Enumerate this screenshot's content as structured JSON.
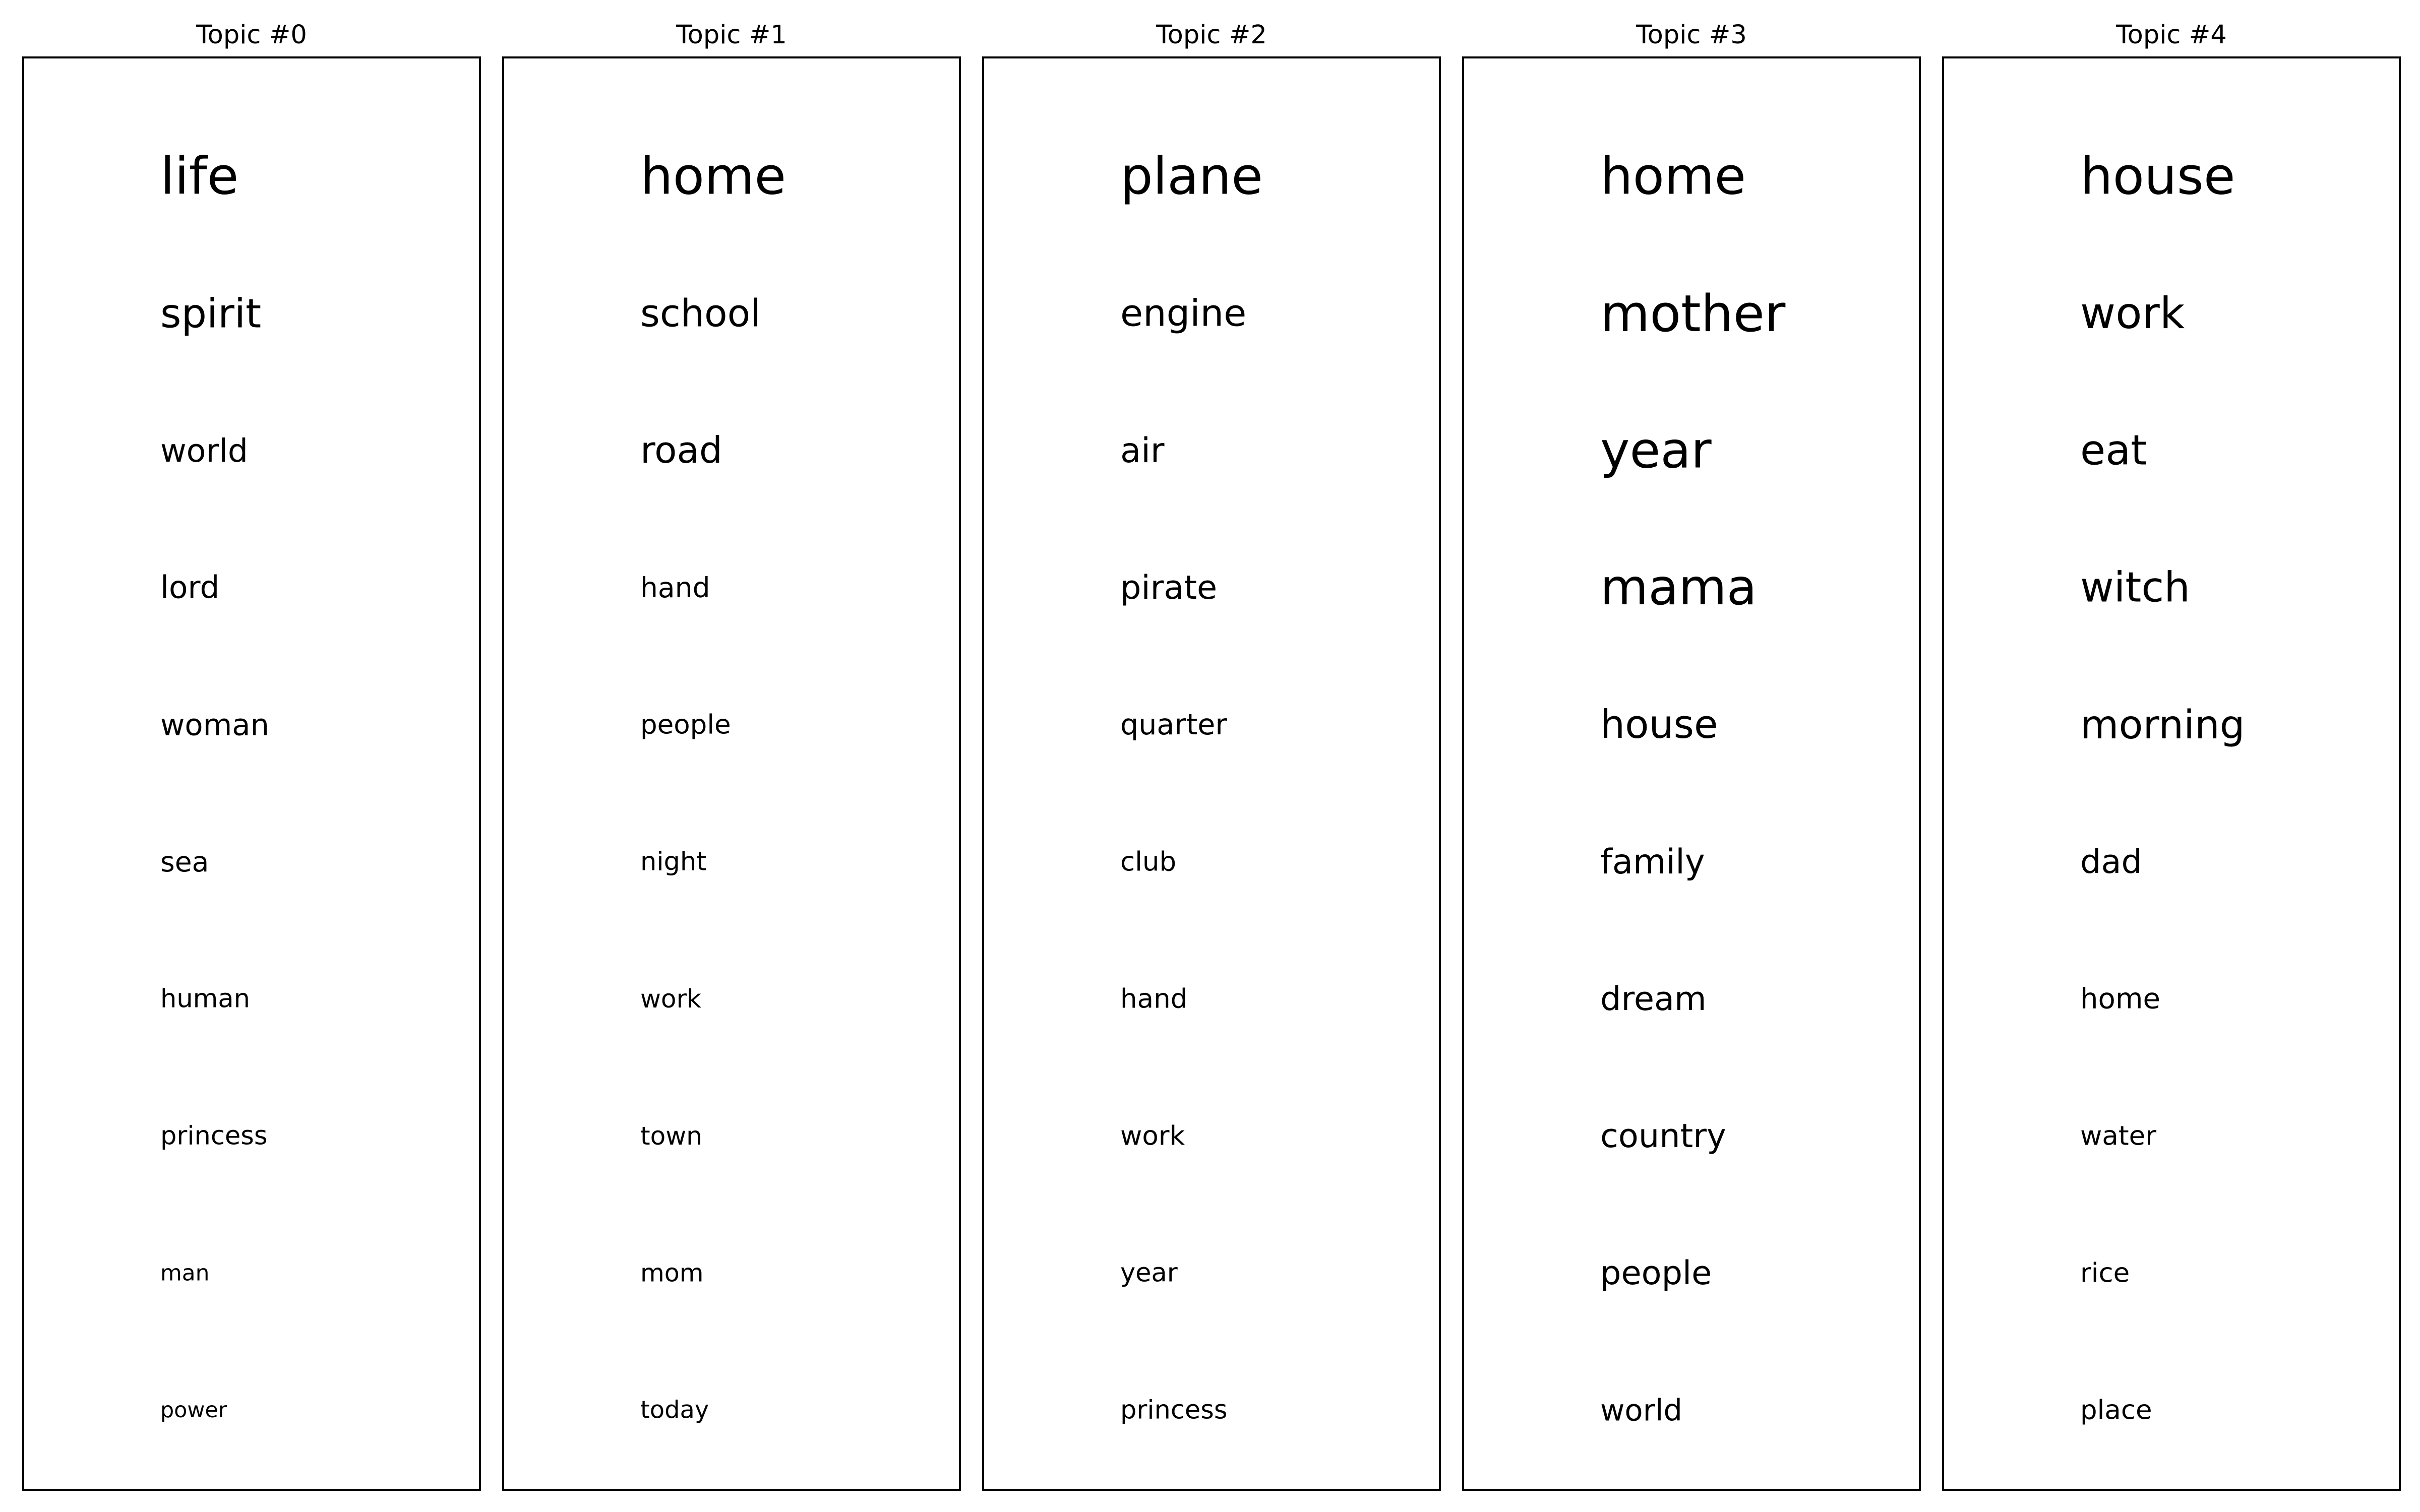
{
  "chart_data": {
    "type": "table",
    "grid": false,
    "panels": [
      {
        "title": "Topic #0",
        "words": [
          "life",
          "spirit",
          "world",
          "lord",
          "woman",
          "sea",
          "human",
          "princess",
          "man",
          "power"
        ],
        "relative_weights": [
          1.0,
          0.78,
          0.62,
          0.6,
          0.58,
          0.54,
          0.5,
          0.5,
          0.43,
          0.42
        ]
      },
      {
        "title": "Topic #1",
        "words": [
          "home",
          "school",
          "road",
          "hand",
          "people",
          "night",
          "work",
          "town",
          "mom",
          "today"
        ],
        "relative_weights": [
          1.0,
          0.73,
          0.71,
          0.54,
          0.52,
          0.5,
          0.49,
          0.49,
          0.48,
          0.47
        ]
      },
      {
        "title": "Topic #2",
        "words": [
          "plane",
          "engine",
          "air",
          "pirate",
          "quarter",
          "club",
          "hand",
          "work",
          "year",
          "princess"
        ],
        "relative_weights": [
          1.0,
          0.72,
          0.66,
          0.64,
          0.56,
          0.52,
          0.52,
          0.52,
          0.5,
          0.5
        ]
      },
      {
        "title": "Topic #3",
        "words": [
          "home",
          "mother",
          "year",
          "mama",
          "house",
          "family",
          "dream",
          "country",
          "people",
          "world"
        ],
        "relative_weights": [
          1.0,
          0.99,
          0.97,
          0.96,
          0.76,
          0.66,
          0.64,
          0.64,
          0.64,
          0.58
        ]
      },
      {
        "title": "Topic #4",
        "words": [
          "house",
          "work",
          "eat",
          "witch",
          "morning",
          "dad",
          "home",
          "water",
          "rice",
          "place"
        ],
        "relative_weights": [
          1.0,
          0.84,
          0.8,
          0.8,
          0.77,
          0.64,
          0.55,
          0.52,
          0.52,
          0.52
        ]
      }
    ]
  }
}
